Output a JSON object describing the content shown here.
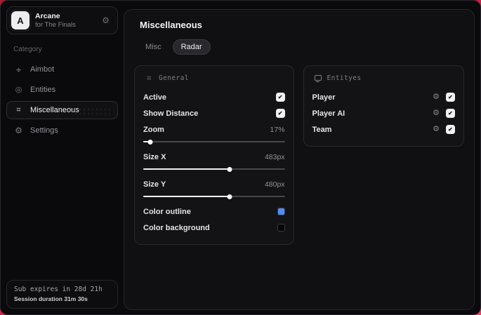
{
  "accent_color": "#d92448",
  "sidebar": {
    "header": {
      "logo_letter": "A",
      "title": "Arcane",
      "subtitle": "for The Finals",
      "gear_icon": "gear-icon"
    },
    "category_label": "Category",
    "items": [
      {
        "label": "Aimbot",
        "icon": "crosshair-icon",
        "active": false
      },
      {
        "label": "Entities",
        "icon": "scan-icon",
        "active": false
      },
      {
        "label": "Miscellaneous",
        "icon": "sliders-icon",
        "active": true
      },
      {
        "label": "Settings",
        "icon": "gear-icon",
        "active": false
      }
    ],
    "footer": {
      "line1": "Sub expires in 28d 21h",
      "line2": "Session duration 31m 30s"
    }
  },
  "main": {
    "title": "Miscellaneous",
    "tabs": [
      {
        "label": "Misc",
        "active": false
      },
      {
        "label": "Radar",
        "active": true
      }
    ],
    "panels": [
      {
        "title": "General",
        "icon": "sliders-icon",
        "rows": [
          {
            "type": "checkbox",
            "label": "Active",
            "checked": true
          },
          {
            "type": "checkbox",
            "label": "Show Distance",
            "checked": true
          },
          {
            "type": "slider",
            "label": "Zoom",
            "value": "17%",
            "percent": 5
          },
          {
            "type": "slider",
            "label": "Size X",
            "value": "483px",
            "percent": 61
          },
          {
            "type": "slider",
            "label": "Size Y",
            "value": "480px",
            "percent": 61
          },
          {
            "type": "color",
            "label": "Color outline",
            "color": "#4e8df6"
          },
          {
            "type": "color",
            "label": "Color background",
            "color": "#050505"
          }
        ]
      },
      {
        "title": "Entityes",
        "icon": "monitor-icon",
        "rows": [
          {
            "type": "entity",
            "label": "Player",
            "checked": true
          },
          {
            "type": "entity",
            "label": "Player AI",
            "checked": true
          },
          {
            "type": "entity",
            "label": "Team",
            "checked": true
          }
        ]
      }
    ]
  }
}
